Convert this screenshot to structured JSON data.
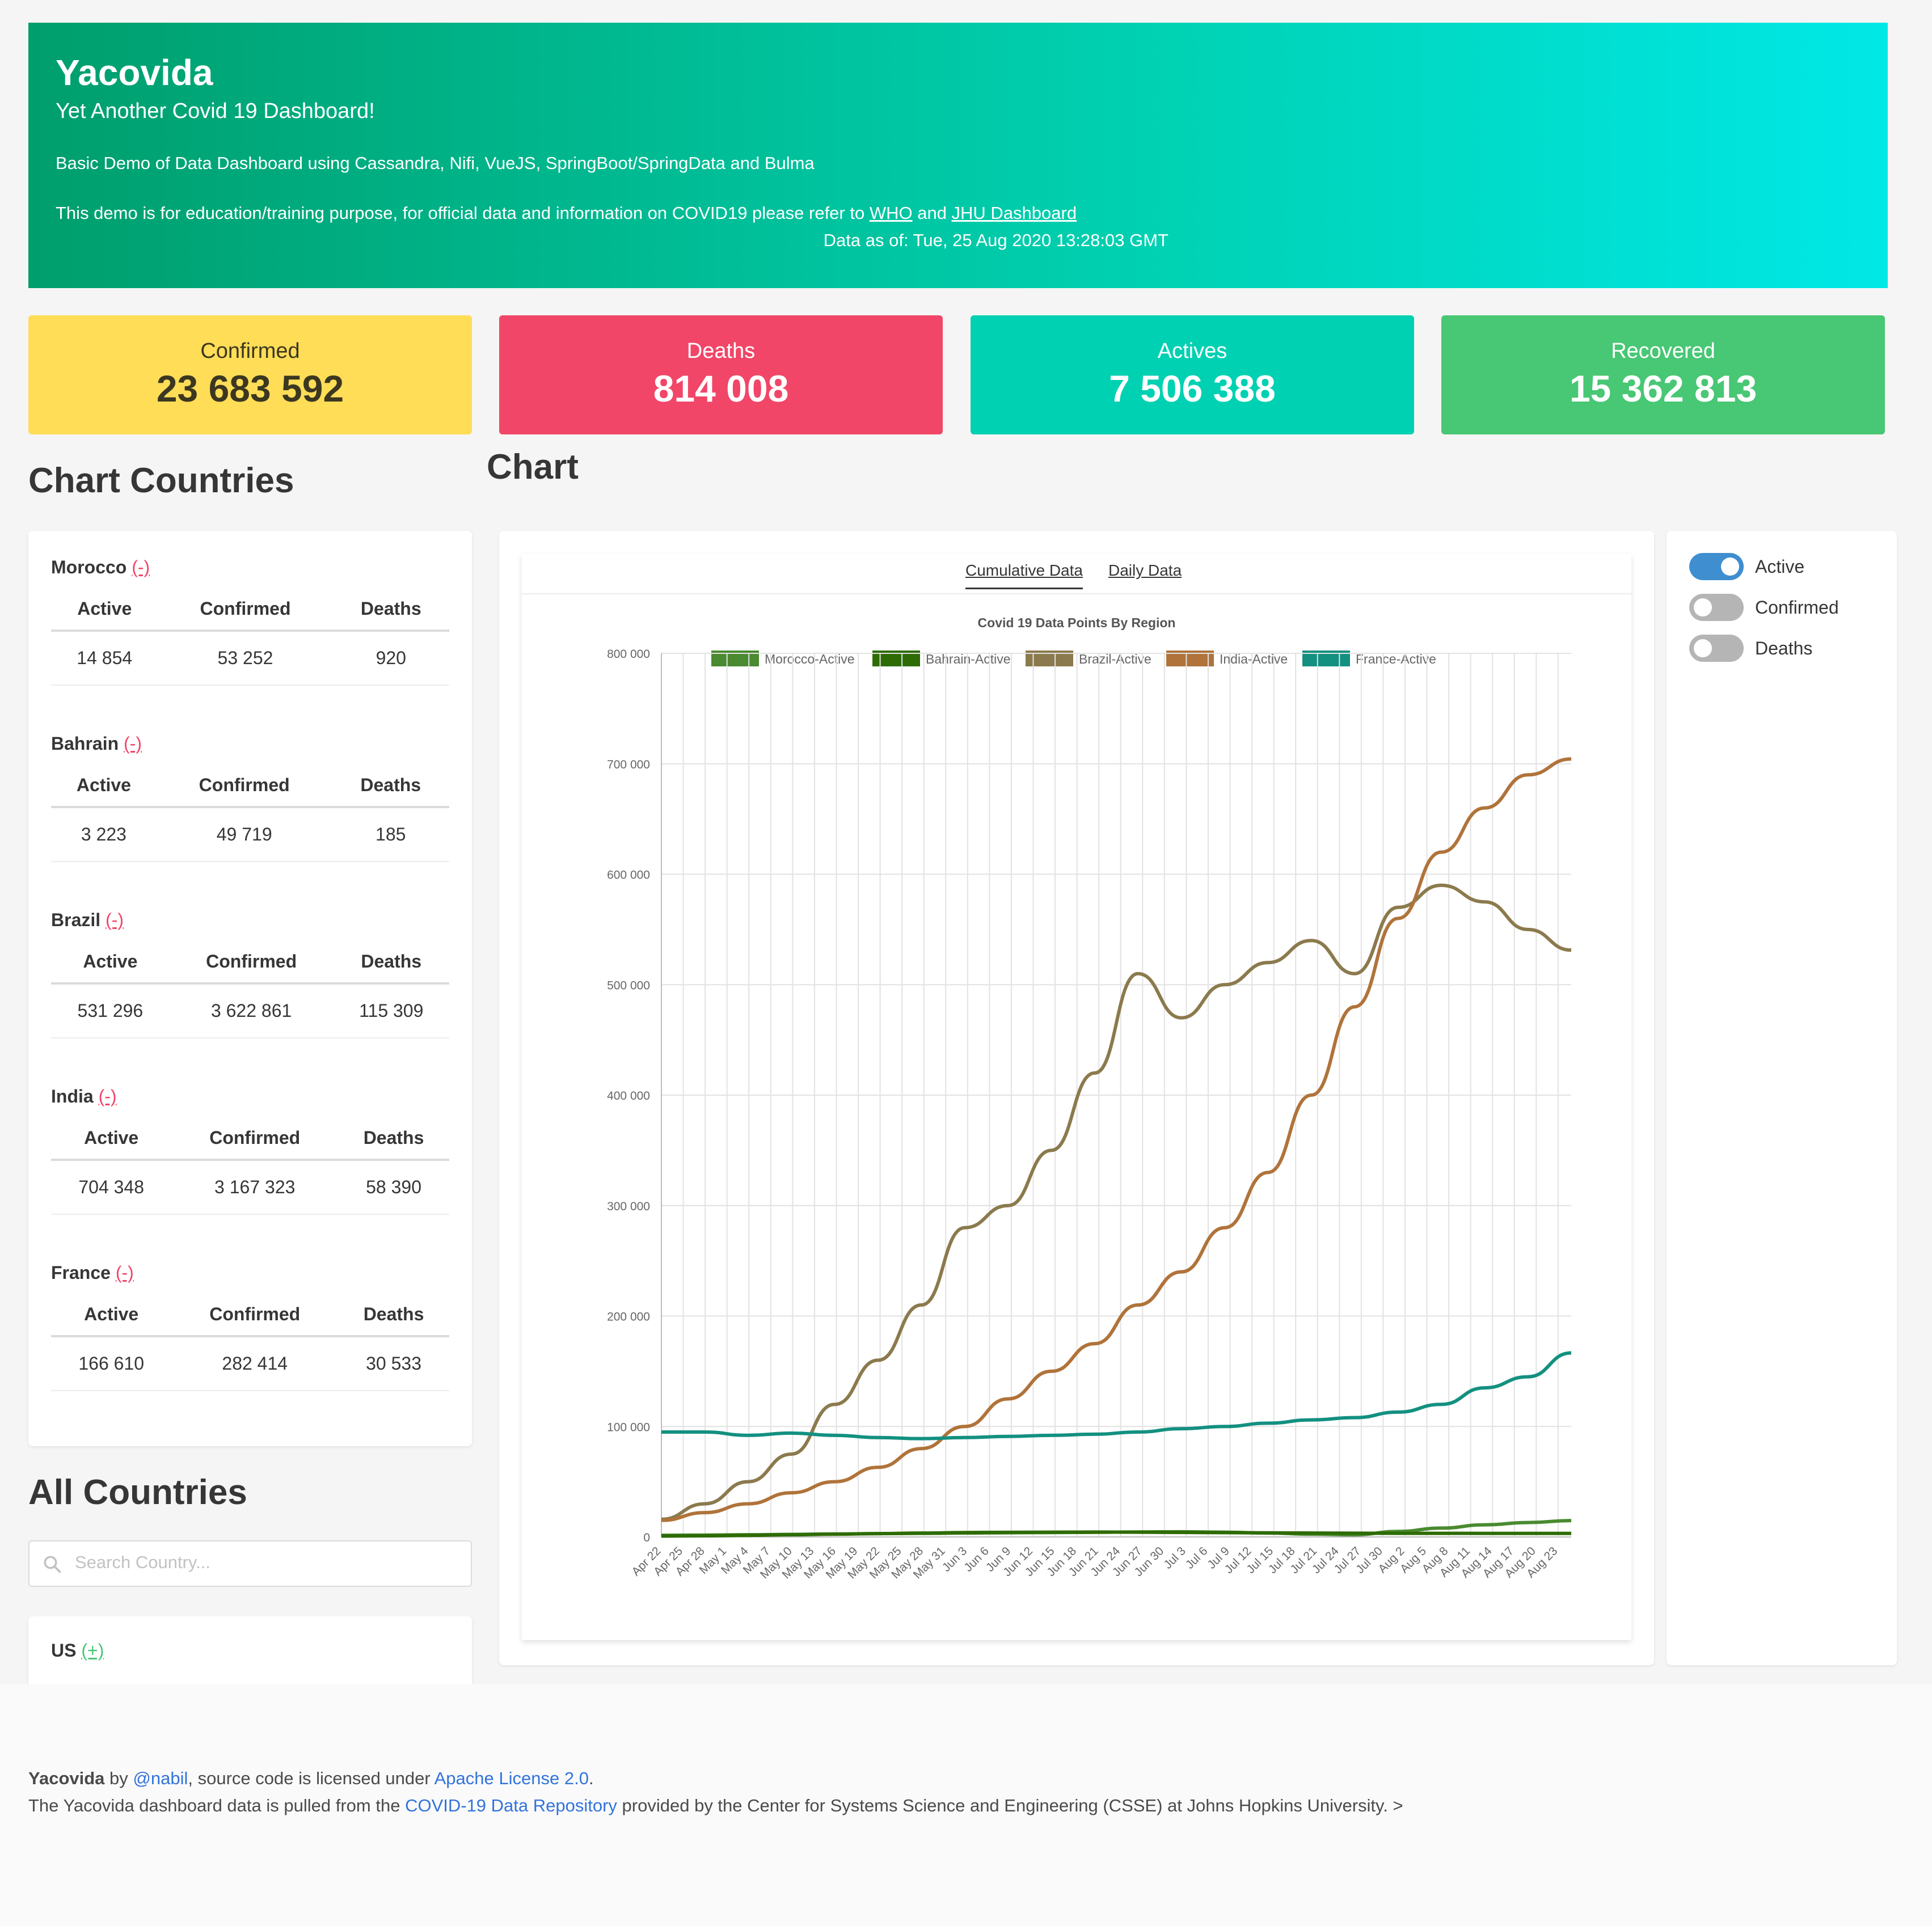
{
  "hero": {
    "title": "Yacovida",
    "subtitle": "Yet Another Covid 19 Dashboard!",
    "description": "Basic Demo of Data Dashboard using Cassandra, Nifi, VueJS, SpringBoot/SpringData and Bulma",
    "info_prefix": "This demo is for education/training purpose, for official data and information on COVID19 please refer to ",
    "who_link": "WHO",
    "and_text": " and ",
    "jhu_link": "JHU Dashboard",
    "data_as_of": "Data as of: Tue, 25 Aug 2020 13:28:03 GMT"
  },
  "stats": {
    "confirmed": {
      "label": "Confirmed",
      "value": "23 683 592",
      "color": "#ffdd57"
    },
    "deaths": {
      "label": "Deaths",
      "value": "814 008",
      "color": "#f14668"
    },
    "actives": {
      "label": "Actives",
      "value": "7 506 388",
      "color": "#00d1b2"
    },
    "recovered": {
      "label": "Recovered",
      "value": "15 362 813",
      "color": "#48c774"
    }
  },
  "chart_countries": {
    "heading": "Chart Countries",
    "remove_label": "(-)",
    "columns": [
      "Active",
      "Confirmed",
      "Deaths"
    ],
    "countries": [
      {
        "name": "Morocco",
        "active": "14 854",
        "confirmed": "53 252",
        "deaths": "920"
      },
      {
        "name": "Bahrain",
        "active": "3 223",
        "confirmed": "49 719",
        "deaths": "185"
      },
      {
        "name": "Brazil",
        "active": "531 296",
        "confirmed": "3 622 861",
        "deaths": "115 309"
      },
      {
        "name": "India",
        "active": "704 348",
        "confirmed": "3 167 323",
        "deaths": "58 390"
      },
      {
        "name": "France",
        "active": "166 610",
        "confirmed": "282 414",
        "deaths": "30 533"
      }
    ]
  },
  "all_countries": {
    "heading": "All Countries",
    "search_placeholder": "Search Country...",
    "first_item": {
      "name": "US",
      "add_label": "(+)"
    }
  },
  "chart_section": {
    "heading": "Chart",
    "tabs": [
      "Cumulative Data",
      "Daily Data"
    ],
    "active_tab": "Cumulative Data"
  },
  "toggles": [
    {
      "label": "Active",
      "on": true
    },
    {
      "label": "Confirmed",
      "on": false
    },
    {
      "label": "Deaths",
      "on": false
    }
  ],
  "chart_data": {
    "type": "line",
    "title": "Covid 19 Data Points By Region",
    "xlabel": "",
    "ylabel": "",
    "ylim": [
      0,
      800000
    ],
    "y_ticks": [
      "0",
      "100 000",
      "200 000",
      "300 000",
      "400 000",
      "500 000",
      "600 000",
      "700 000",
      "800 000"
    ],
    "grid": true,
    "legend_position": "top",
    "x_tick_labels": [
      "Apr 22",
      "Apr 25",
      "Apr 28",
      "May 1",
      "May 4",
      "May 7",
      "May 10",
      "May 13",
      "May 16",
      "May 19",
      "May 22",
      "May 25",
      "May 28",
      "May 31",
      "Jun 3",
      "Jun 6",
      "Jun 9",
      "Jun 12",
      "Jun 15",
      "Jun 18",
      "Jun 21",
      "Jun 24",
      "Jun 27",
      "Jun 30",
      "Jul 3",
      "Jul 6",
      "Jul 9",
      "Jul 12",
      "Jul 15",
      "Jul 18",
      "Jul 21",
      "Jul 24",
      "Jul 27",
      "Jul 30",
      "Aug 2",
      "Aug 5",
      "Aug 8",
      "Aug 11",
      "Aug 14",
      "Aug 17",
      "Aug 20",
      "Aug 23"
    ],
    "x": [
      "Apr 22",
      "Apr 28",
      "May 4",
      "May 10",
      "May 16",
      "May 22",
      "May 28",
      "Jun 3",
      "Jun 9",
      "Jun 15",
      "Jun 21",
      "Jun 27",
      "Jul 3",
      "Jul 9",
      "Jul 15",
      "Jul 21",
      "Jul 27",
      "Aug 2",
      "Aug 8",
      "Aug 14",
      "Aug 20",
      "Aug 24"
    ],
    "series": [
      {
        "name": "Morocco-Active",
        "color": "#4a8a30",
        "values": [
          1500,
          1700,
          2000,
          2300,
          2700,
          3000,
          3200,
          3500,
          3800,
          4000,
          4200,
          4500,
          4700,
          4300,
          3500,
          2500,
          2000,
          5000,
          8000,
          11000,
          13000,
          14854
        ]
      },
      {
        "name": "Bahrain-Active",
        "color": "#2e6b05",
        "values": [
          800,
          1000,
          1500,
          2000,
          2500,
          3000,
          3500,
          4000,
          4200,
          4300,
          4400,
          4300,
          4100,
          3900,
          3700,
          3500,
          3400,
          3300,
          3300,
          3200,
          3200,
          3223
        ]
      },
      {
        "name": "Brazil-Active",
        "color": "#8b7a4d",
        "values": [
          16000,
          30000,
          50000,
          75000,
          120000,
          160000,
          210000,
          280000,
          300000,
          350000,
          420000,
          510000,
          470000,
          500000,
          520000,
          540000,
          510000,
          570000,
          590000,
          575000,
          550000,
          531296
        ]
      },
      {
        "name": "India-Active",
        "color": "#b0733a",
        "values": [
          15000,
          22000,
          30000,
          40000,
          50000,
          63000,
          80000,
          100000,
          125000,
          150000,
          175000,
          210000,
          240000,
          280000,
          330000,
          400000,
          480000,
          560000,
          620000,
          660000,
          690000,
          704348
        ]
      },
      {
        "name": "France-Active",
        "color": "#139080",
        "values": [
          95000,
          95000,
          92000,
          94000,
          92000,
          90000,
          89000,
          90000,
          91000,
          92000,
          93000,
          95000,
          98000,
          100000,
          103000,
          106000,
          108000,
          113000,
          120000,
          135000,
          145000,
          166610
        ]
      }
    ]
  },
  "footer": {
    "brand": "Yacovida",
    "by": " by ",
    "author_link": "@nabil",
    "license_prefix": ", source code is licensed under ",
    "license_link": "Apache License 2.0",
    "license_suffix": ".",
    "data_prefix": "The Yacovida dashboard data is pulled from the ",
    "repo_link": "COVID-19 Data Repository",
    "data_suffix": " provided by the Center for Systems Science and Engineering (CSSE) at Johns Hopkins University. >"
  }
}
